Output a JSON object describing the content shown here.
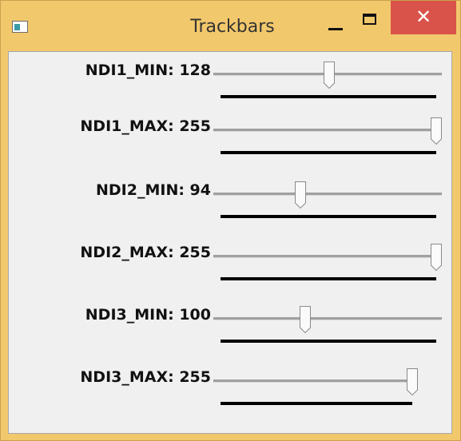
{
  "window": {
    "title": "Trackbars",
    "close_glyph": "✕",
    "icons": {
      "app": "app-window-icon",
      "minimize": "minimize-icon",
      "maximize": "maximize-icon",
      "close": "close-icon"
    },
    "colors": {
      "frame": "#F2C86C",
      "close_button": "#D9534A",
      "client_bg": "#F0F0F0"
    }
  },
  "trackbars": [
    {
      "label": "NDI1_MIN: 128",
      "value": 128,
      "max": 255
    },
    {
      "label": "NDI1_MAX: 255",
      "value": 255,
      "max": 255
    },
    {
      "label": "NDI2_MIN: 94",
      "value": 94,
      "max": 255
    },
    {
      "label": "NDI2_MAX: 255",
      "value": 255,
      "max": 255
    },
    {
      "label": "NDI3_MIN: 100",
      "value": 100,
      "max": 255
    },
    {
      "label": "NDI3_MAX: 255",
      "value": 255,
      "max": 255
    }
  ]
}
